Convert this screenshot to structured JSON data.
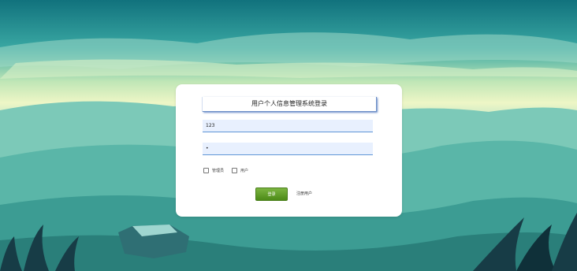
{
  "login": {
    "title": "用户个人信息管理系统登录",
    "username_value": "123",
    "password_value": "•",
    "roles": [
      {
        "label": "管理员",
        "checked": false
      },
      {
        "label": "用户",
        "checked": false
      }
    ],
    "login_button": "登录",
    "register_link": "注册用户"
  }
}
